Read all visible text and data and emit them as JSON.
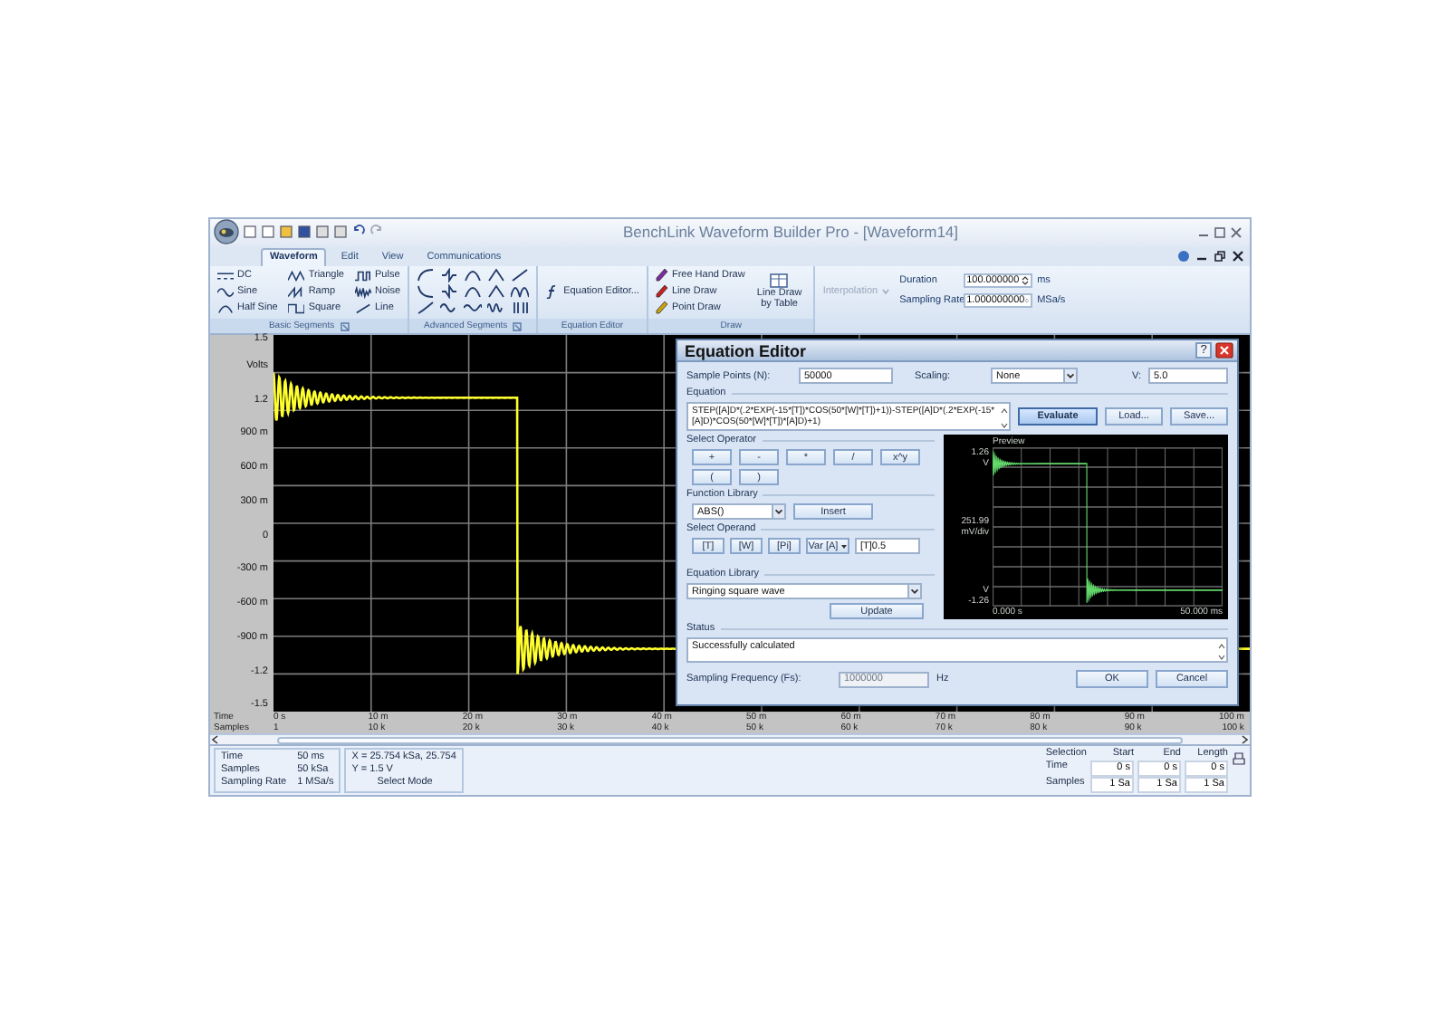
{
  "window": {
    "title": "BenchLink Waveform Builder Pro - [Waveform14]"
  },
  "ribbon_tabs": [
    {
      "label": "Waveform",
      "selected": true
    },
    {
      "label": "Edit",
      "selected": false
    },
    {
      "label": "View",
      "selected": false
    },
    {
      "label": "Communications",
      "selected": false
    }
  ],
  "ribbon_groups": [
    {
      "kind": "segments",
      "title": "Basic Segments",
      "launcher": true,
      "items": [
        {
          "label": "DC"
        },
        {
          "label": "Sine"
        },
        {
          "label": "Half Sine"
        },
        {
          "label": "Triangle"
        },
        {
          "label": "Ramp"
        },
        {
          "label": "Square"
        },
        {
          "label": "Pulse"
        },
        {
          "label": "Noise"
        },
        {
          "label": "Line"
        }
      ]
    },
    {
      "kind": "icons",
      "title": "Advanced Segments",
      "launcher": true
    },
    {
      "kind": "button",
      "title": "Equation Editor",
      "items": [
        {
          "label": "Equation Editor..."
        }
      ]
    },
    {
      "kind": "draw",
      "title": "Draw",
      "items": [
        {
          "label": "Free Hand Draw"
        },
        {
          "label": "Line Draw"
        },
        {
          "label": "Point Draw"
        }
      ],
      "big": {
        "label": "Line Draw by Table"
      }
    }
  ],
  "interpolation": {
    "label": "Interpolation",
    "disabled": true
  },
  "duration": {
    "label": "Duration",
    "value": "100.000000",
    "unit": "ms"
  },
  "sampling_rate": {
    "label": "Sampling Rate",
    "value": "1.000000000",
    "unit": "MSa/s"
  },
  "plot": {
    "y_unit": "Volts",
    "y_labels": [
      "1.5",
      "1.2",
      "900 m",
      "600 m",
      "300 m",
      "0",
      "-300 m",
      "-600 m",
      "-900 m",
      "-1.2",
      "-1.5"
    ],
    "x_row_labels": [
      "Time",
      "Samples"
    ],
    "x_ticks": [
      {
        "time": "0 s",
        "samples": "1"
      },
      {
        "time": "10 m",
        "samples": "10 k"
      },
      {
        "time": "20 m",
        "samples": "20 k"
      },
      {
        "time": "30 m",
        "samples": "30 k"
      },
      {
        "time": "40 m",
        "samples": "40 k"
      },
      {
        "time": "50 m",
        "samples": "50 k"
      },
      {
        "time": "60 m",
        "samples": "60 k"
      },
      {
        "time": "70 m",
        "samples": "70 k"
      },
      {
        "time": "80 m",
        "samples": "80 k"
      },
      {
        "time": "90 m",
        "samples": "90 k"
      },
      {
        "time": "100 m",
        "samples": "100 k"
      }
    ]
  },
  "status": {
    "fields": [
      {
        "label": "Time",
        "value": "50 ms"
      },
      {
        "label": "Samples",
        "value": "50 kSa"
      },
      {
        "label": "Sampling Rate",
        "value": "1 MSa/s"
      }
    ],
    "cursor": [
      "X = 25.754 kSa, 25.754",
      "Y = 1.5 V"
    ],
    "mode": "Select Mode",
    "selection": {
      "title": "Selection",
      "columns": [
        "Start",
        "End",
        "Length"
      ],
      "rows": [
        {
          "label": "Time",
          "values": [
            "0 s",
            "0 s",
            "0 s"
          ]
        },
        {
          "label": "Samples",
          "values": [
            "1 Sa",
            "1 Sa",
            "1 Sa"
          ]
        }
      ]
    }
  },
  "equation_editor": {
    "title": "Equation Editor",
    "help_button": "?",
    "sample_points": {
      "label": "Sample Points (N):",
      "value": "50000"
    },
    "scaling": {
      "label": "Scaling:",
      "value": "None"
    },
    "v": {
      "label": "V:",
      "value": "5.0"
    },
    "equation": {
      "label": "Equation",
      "value": "STEP([A]D*(.2*EXP(-15*[T])*COS(50*[W]*[T])+1))-STEP([A]D*(.2*EXP(-15*[A]D)*COS(50*[W]*[T])*[A]D)+1)"
    },
    "actions": [
      {
        "label": "Evaluate",
        "focused": true
      },
      {
        "label": "Load...",
        "focused": false
      },
      {
        "label": "Save...",
        "focused": false
      }
    ],
    "operators": {
      "label": "Select Operator",
      "buttons": [
        "+",
        "-",
        "*",
        "/",
        "x^y",
        "(",
        ")"
      ]
    },
    "function_library": {
      "label": "Function Library",
      "value": "ABS()",
      "button": "Insert"
    },
    "operands": {
      "label": "Select Operand",
      "buttons": [
        "[T]",
        "[W]",
        "[Pi]"
      ],
      "var_button": "Var [A]",
      "value": "[T]0.5"
    },
    "equation_library": {
      "label": "Equation Library",
      "value": "Ringing square wave",
      "button": "Update"
    },
    "preview": {
      "title": "Preview",
      "y_max": "1.26",
      "unit_top": "V",
      "div": "251.99",
      "div_unit": "mV/div",
      "unit_bottom": "V",
      "y_min": "-1.26",
      "x_start": "0.000 s",
      "x_end": "50.000 ms"
    },
    "status": {
      "label": "Status",
      "value": "Successfully calculated"
    },
    "sampling_frequency": {
      "label": "Sampling Frequency (Fs):",
      "value": "1000000",
      "unit": "Hz",
      "disabled": true
    },
    "buttons": [
      {
        "label": "OK"
      },
      {
        "label": "Cancel"
      }
    ]
  }
}
